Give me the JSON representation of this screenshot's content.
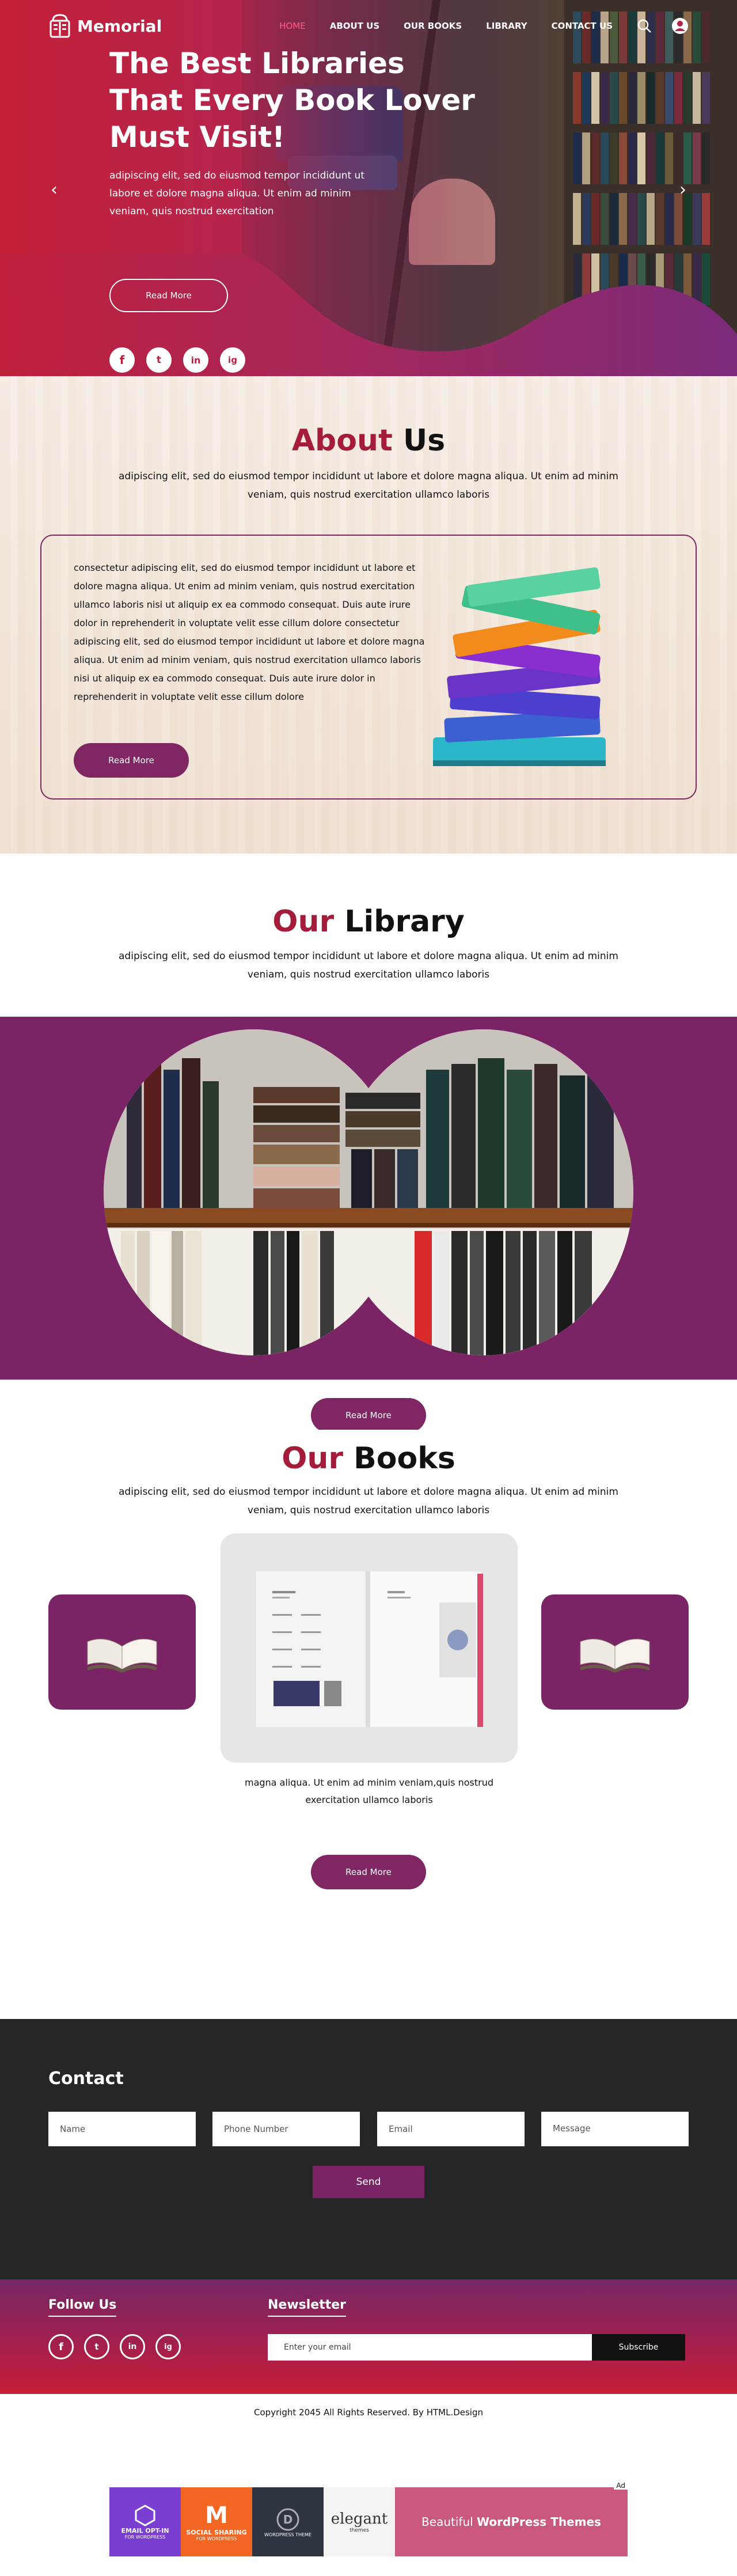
{
  "brand": {
    "name": "Memorial"
  },
  "nav": {
    "items": [
      {
        "label": "HOME",
        "active": true
      },
      {
        "label": "ABOUT US"
      },
      {
        "label": "OUR BOOKS"
      },
      {
        "label": "LIBRARY"
      },
      {
        "label": "CONTACT US"
      }
    ],
    "icons": [
      "search-icon",
      "user-icon"
    ]
  },
  "hero": {
    "title": "The Best Libraries That Every Book Lover Must Visit!",
    "description": "adipiscing elit, sed do eiusmod tempor incididunt ut labore et dolore magna aliqua. Ut enim ad minim veniam, quis nostrud exercitation",
    "button": "Read More",
    "social": [
      "f",
      "t",
      "in",
      "ig"
    ]
  },
  "about": {
    "title_highlight": "About",
    "title_rest": " Us",
    "description": "adipiscing elit, sed do eiusmod tempor incididunt ut labore et dolore magna aliqua. Ut enim ad minim veniam, quis nostrud exercitation ullamco laboris",
    "card_text": "consectetur adipiscing elit, sed do eiusmod tempor incididunt ut labore et dolore magna aliqua. Ut enim ad minim veniam, quis nostrud exercitation ullamco laboris nisi ut aliquip ex ea commodo consequat. Duis aute irure dolor in reprehenderit in voluptate velit esse cillum dolore consectetur adipiscing elit, sed do eiusmod tempor incididunt ut labore et dolore magna aliqua. Ut enim ad minim veniam, quis nostrud exercitation ullamco laboris nisi ut aliquip ex ea commodo consequat. Duis aute irure dolor in reprehenderit in voluptate velit esse cillum dolore",
    "button": "Read More"
  },
  "library": {
    "title_highlight": "Our",
    "title_rest": " Library",
    "description": "adipiscing elit, sed do eiusmod tempor incididunt ut labore et dolore magna aliqua. Ut enim ad minim veniam, quis nostrud exercitation ullamco laboris",
    "button": "Read More"
  },
  "books": {
    "title_highlight": "Our",
    "title_rest": " Books",
    "description": "adipiscing elit, sed do eiusmod tempor incididunt ut labore et dolore magna aliqua. Ut enim ad minim veniam, quis nostrud exercitation ullamco laboris",
    "caption": "magna aliqua. Ut enim ad minim veniam,quis nostrud exercitation ullamco laboris",
    "button": "Read More"
  },
  "contact": {
    "title": "Contact",
    "placeholders": {
      "name": "Name",
      "phone": "Phone Number",
      "email": "Email",
      "message": "Message"
    },
    "send": "Send"
  },
  "footer": {
    "follow_title": "Follow Us",
    "newsletter_title": "Newsletter",
    "newsletter_placeholder": "Enter your email",
    "subscribe": "Subscribe",
    "copyright": "Copyright 2045 All Rights Reserved. By HTML.Design"
  },
  "ad": {
    "tag": "Ad",
    "tiles": [
      {
        "line1": "EMAIL OPT-IN",
        "line2": "FOR WORDPRESS"
      },
      {
        "line1": "SOCIAL SHARING",
        "line2": "FOR WORDPRESS"
      },
      {
        "line1": "WORDPRESS THEME",
        "line2": ""
      },
      {
        "line1": "elegant",
        "line2": "themes"
      }
    ],
    "headline_prefix": "Beautiful ",
    "headline_bold": "WordPress Themes"
  },
  "colors": {
    "primary": "#7b2465",
    "accent_red": "#a51c3a",
    "dark": "#262626"
  }
}
